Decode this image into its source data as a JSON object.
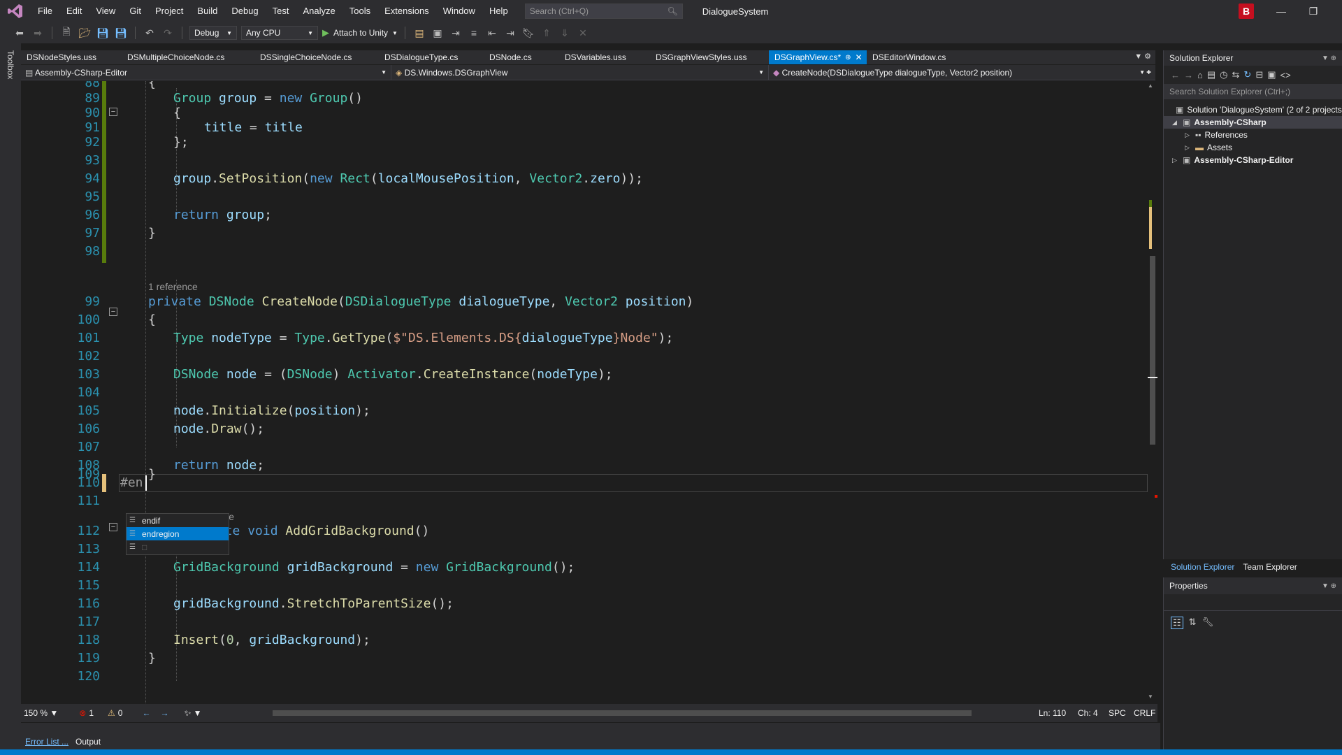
{
  "menu": {
    "items": [
      "File",
      "Edit",
      "View",
      "Git",
      "Project",
      "Build",
      "Debug",
      "Test",
      "Analyze",
      "Tools",
      "Extensions",
      "Window",
      "Help"
    ],
    "search_placeholder": "Search (Ctrl+Q)",
    "solution_name": "DialogueSystem",
    "account_initial": "B"
  },
  "toolbar": {
    "configuration": "Debug",
    "platform": "Any CPU",
    "attach_label": "Attach to Unity"
  },
  "toolbox_label": "Toolbox",
  "tabs": [
    {
      "label": "DSNodeStyles.uss",
      "active": false
    },
    {
      "label": "DSMultipleChoiceNode.cs",
      "active": false
    },
    {
      "label": "DSSingleChoiceNode.cs",
      "active": false
    },
    {
      "label": "DSDialogueType.cs",
      "active": false
    },
    {
      "label": "DSNode.cs",
      "active": false
    },
    {
      "label": "DSVariables.uss",
      "active": false
    },
    {
      "label": "DSGraphViewStyles.uss",
      "active": false
    },
    {
      "label": "DSGraphView.cs*",
      "active": true
    },
    {
      "label": "DSEditorWindow.cs",
      "active": false
    }
  ],
  "navbar": {
    "project": "Assembly-CSharp-Editor",
    "type": "DS.Windows.DSGraphView",
    "member": "CreateNode(DSDialogueType dialogueType, Vector2 position)"
  },
  "code": {
    "line_numbers": [
      "88",
      "89",
      "90",
      "91",
      "92",
      "93",
      "94",
      "95",
      "96",
      "97",
      "98",
      "99",
      "100",
      "101",
      "102",
      "103",
      "104",
      "105",
      "106",
      "107",
      "108",
      "109",
      "110",
      "111",
      "112",
      "113",
      "114",
      "115",
      "116",
      "117",
      "118",
      "119",
      "120"
    ],
    "lines": {
      "l88": "{",
      "l89_kw_type": "Group",
      "l89_var": "group",
      "l89_eq": " = ",
      "l89_new": "new",
      "l89_ctor": "Group",
      "l89_end": "()",
      "l90": "{",
      "l91_a": "title",
      "l91_b": " = ",
      "l91_c": "title",
      "l92": "};",
      "l94_obj": "group",
      "l94_method": "SetPosition",
      "l94_new": "new",
      "l94_rect": "Rect",
      "l94_arg": "localMousePosition",
      "l94_vec": "Vector2",
      "l94_zero": "zero",
      "l96_ret": "return",
      "l96_val": "group",
      "l97": "}",
      "ref_1": "1 reference",
      "l99_private": "private",
      "l99_type": "DSNode",
      "l99_method": "CreateNode",
      "l99_ptype": "DSDialogueType",
      "l99_pname": "dialogueType",
      "l99_ptype2": "Vector2",
      "l99_pname2": "position",
      "l100": "{",
      "l101_type": "Type",
      "l101_var": "nodeType",
      "l101_cls": "Type",
      "l101_method": "GetType",
      "l101_str1": "$\"DS.Elements.DS{",
      "l101_interp": "dialogueType",
      "l101_str2": "}Node\"",
      "l103_type": "DSNode",
      "l103_var": "node",
      "l103_cast": "DSNode",
      "l103_cls": "Activator",
      "l103_method": "CreateInstance",
      "l103_arg": "nodeType",
      "l105_obj": "node",
      "l105_method": "Initialize",
      "l105_arg": "position",
      "l106_obj": "node",
      "l106_method": "Draw",
      "l108_ret": "return",
      "l108_val": "node",
      "l109": "}",
      "l110_typed": "#en",
      "ref_2_tail": "rence",
      "l112_tail": "vate",
      "l112_void": "void",
      "l112_method": "AddGridBackground",
      "l113": "{",
      "l114_type": "GridBackground",
      "l114_var": "gridBackground",
      "l114_new": "new",
      "l114_ctor": "GridBackground",
      "l116_obj": "gridBackground",
      "l116_method": "StretchToParentSize",
      "l118_method": "Insert",
      "l118_num": "0",
      "l118_arg": "gridBackground",
      "l119": "}"
    }
  },
  "completion": {
    "items": [
      "endif",
      "endregion"
    ],
    "selected_index": 1
  },
  "editor_status": {
    "zoom": "150 %",
    "errors": "1",
    "warnings": "0",
    "line": "Ln: 110",
    "col": "Ch: 4",
    "whitespace": "SPC",
    "eol": "CRLF"
  },
  "bottom_tabs": [
    "Error List ...",
    "Output"
  ],
  "solution_explorer": {
    "title": "Solution Explorer",
    "search_placeholder": "Search Solution Explorer (Ctrl+;)",
    "tree": [
      {
        "label": "Solution 'DialogueSystem' (2 of 2 projects)",
        "indent": 0,
        "arrow": "",
        "bold": false
      },
      {
        "label": "Assembly-CSharp",
        "indent": 1,
        "arrow": "◢",
        "bold": true
      },
      {
        "label": "References",
        "indent": 2,
        "arrow": "▷",
        "bold": false
      },
      {
        "label": "Assets",
        "indent": 2,
        "arrow": "▷",
        "bold": false
      },
      {
        "label": "Assembly-CSharp-Editor",
        "indent": 1,
        "arrow": "▷",
        "bold": true
      }
    ],
    "bottom_tabs": [
      "Solution Explorer",
      "Team Explorer"
    ]
  },
  "properties": {
    "title": "Properties"
  },
  "colors": {
    "accent": "#007acc",
    "keyword": "#569cd6",
    "type": "#4ec9b0",
    "string": "#d69d85",
    "method": "#dcdcaa",
    "variable": "#9cdcfe",
    "line_number": "#2b91af"
  }
}
